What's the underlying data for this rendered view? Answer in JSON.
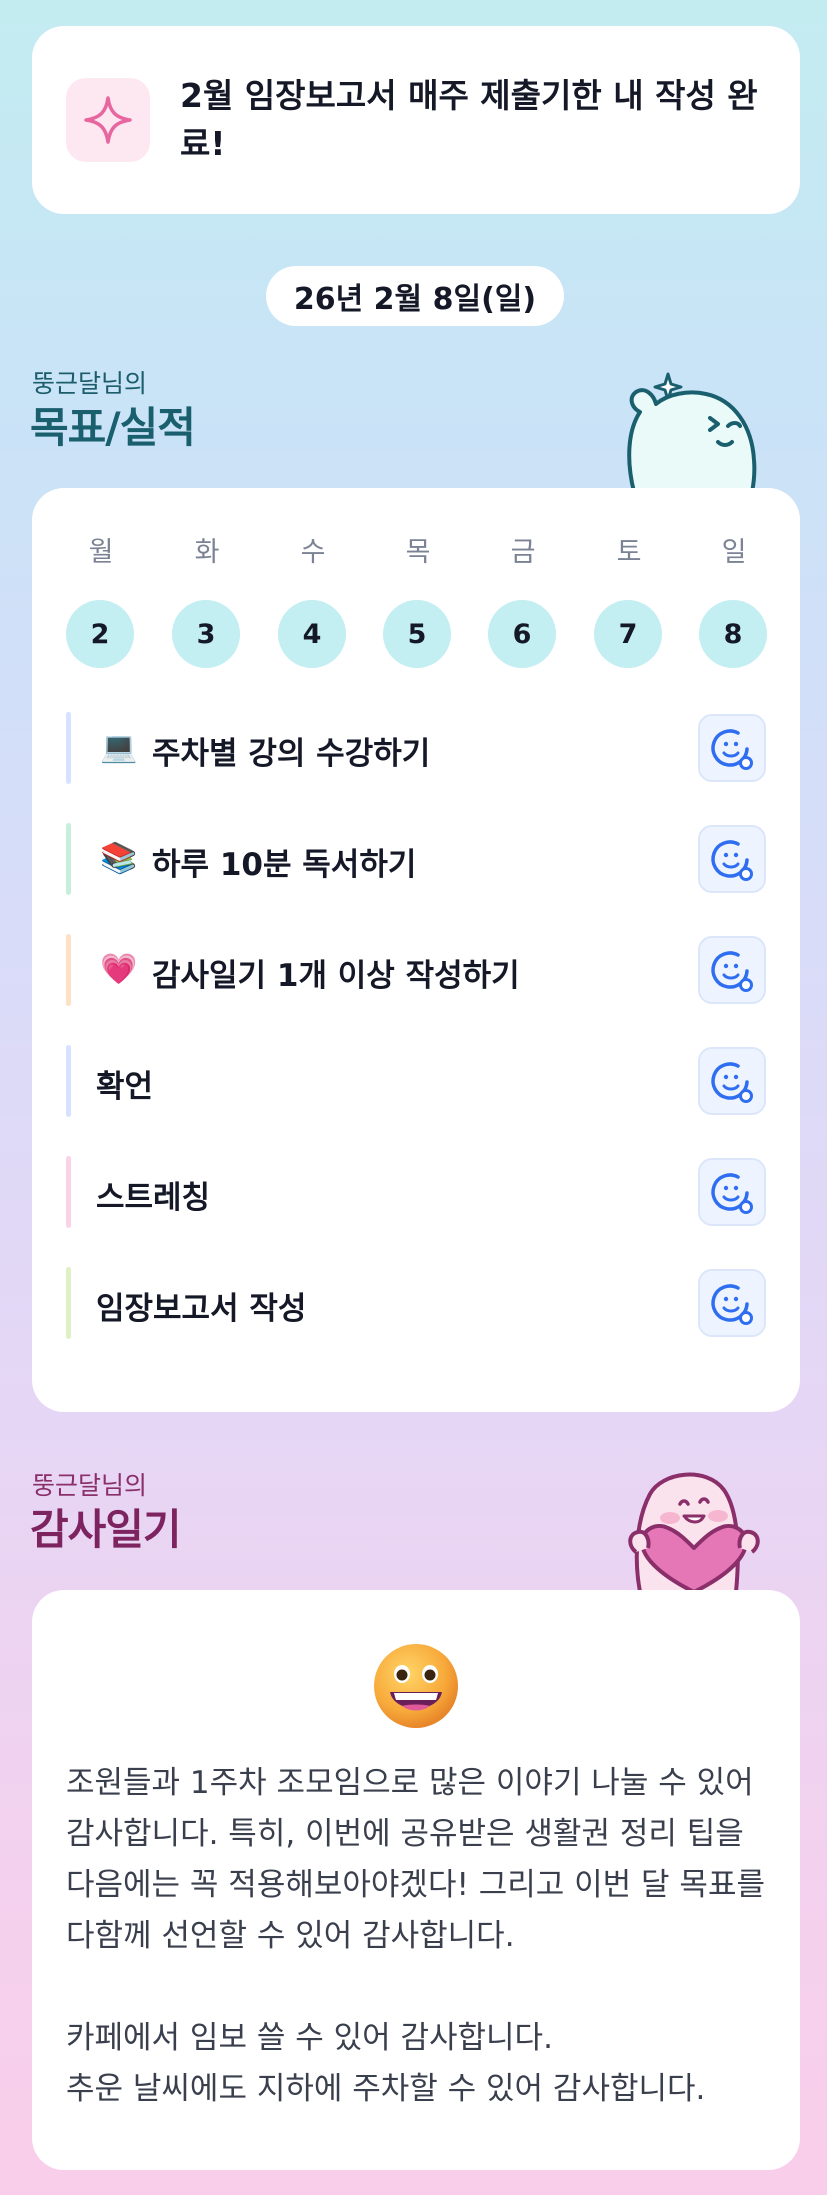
{
  "banner": {
    "icon": "sparkle-icon",
    "text": "2월 임장보고서 매주 제출기한 내 작성 완료!"
  },
  "date_label": "26년 2월 8일(일)",
  "goals_section": {
    "subtitle": "뚱근달님의",
    "title": "목표/실적"
  },
  "week": {
    "days": [
      "월",
      "화",
      "수",
      "목",
      "금",
      "토",
      "일"
    ],
    "dates": [
      "2",
      "3",
      "4",
      "5",
      "6",
      "7",
      "8"
    ]
  },
  "goals": [
    {
      "label": "주차별 강의 수강하기",
      "emoji": "💻",
      "icon": "laptop-icon",
      "bar_color": "#d6e2ff"
    },
    {
      "label": "하루 10분 독서하기",
      "emoji": "📚",
      "icon": "books-icon",
      "bar_color": "#c6f0dc"
    },
    {
      "label": "감사일기 1개 이상 작성하기",
      "emoji": "💗",
      "icon": "heart-icon",
      "bar_color": "#fde1c4"
    },
    {
      "label": "확언",
      "emoji": "",
      "icon": "",
      "bar_color": "#d6e2ff"
    },
    {
      "label": "스트레칭",
      "emoji": "",
      "icon": "",
      "bar_color": "#fbd3e9"
    },
    {
      "label": "임장보고서 작성",
      "emoji": "",
      "icon": "",
      "bar_color": "#dff0c2"
    }
  ],
  "gratitude_section": {
    "subtitle": "뚱근달님의",
    "title": "감사일기"
  },
  "gratitude": {
    "icon": "grinning-face-icon",
    "text": "조원들과 1주차 조모임으로 많은 이야기 나눌 수 있어 감사합니다. 특히, 이번에 공유받은 생활권 정리 팁을 다음에는 꼭 적용해보아야겠다! 그리고 이번 달 목표를 다함께 선언할 수 있어 감사합니다.\n\n카페에서 임보 쓸 수 있어 감사합니다.\n추운 날씨에도 지하에 주차할 수 있어 감사합니다."
  },
  "colors": {
    "accent_teal": "#1a5f6e",
    "accent_plum": "#7d2460",
    "date_circle": "#c3eef2",
    "react_icon": "#2f6ef0"
  }
}
